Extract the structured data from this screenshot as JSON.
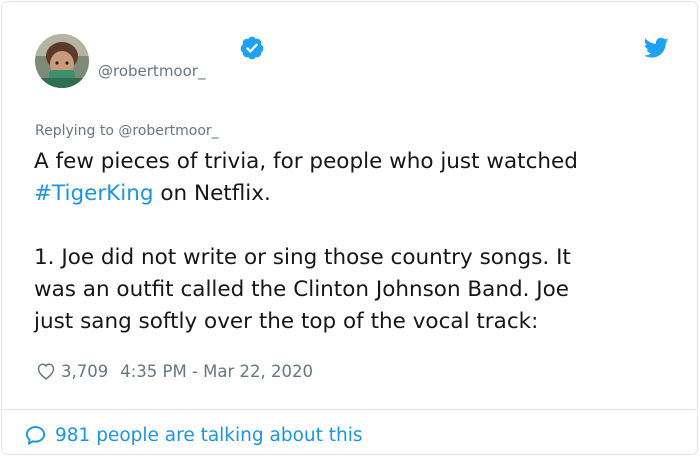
{
  "tweet": {
    "handle": "@robertmoor_",
    "replying_prefix": "Replying to ",
    "replying_user": "@robertmoor_",
    "line1": "A few pieces of trivia, for people who just watched",
    "hashtag": "#TigerKing",
    "line2_rest": " on Netflix.",
    "para2": [
      "1. Joe did not write or sing those country songs. It",
      "was an outfit called the Clinton Johnson Band. Joe",
      "just sang softly over the top of the vocal track:"
    ],
    "likes": "3,709",
    "timestamp": "4:35 PM - Mar 22, 2020",
    "talking": "981 people are talking about this"
  },
  "icons": {
    "avatar": "avatar-photo",
    "verified": "verified-badge-icon",
    "brand": "twitter-bird-icon",
    "like": "heart-icon",
    "reply": "speech-bubble-icon"
  },
  "colors": {
    "accent": "#1b95e0",
    "muted": "#657786",
    "text": "#14171a",
    "border": "#e1e8ed"
  }
}
